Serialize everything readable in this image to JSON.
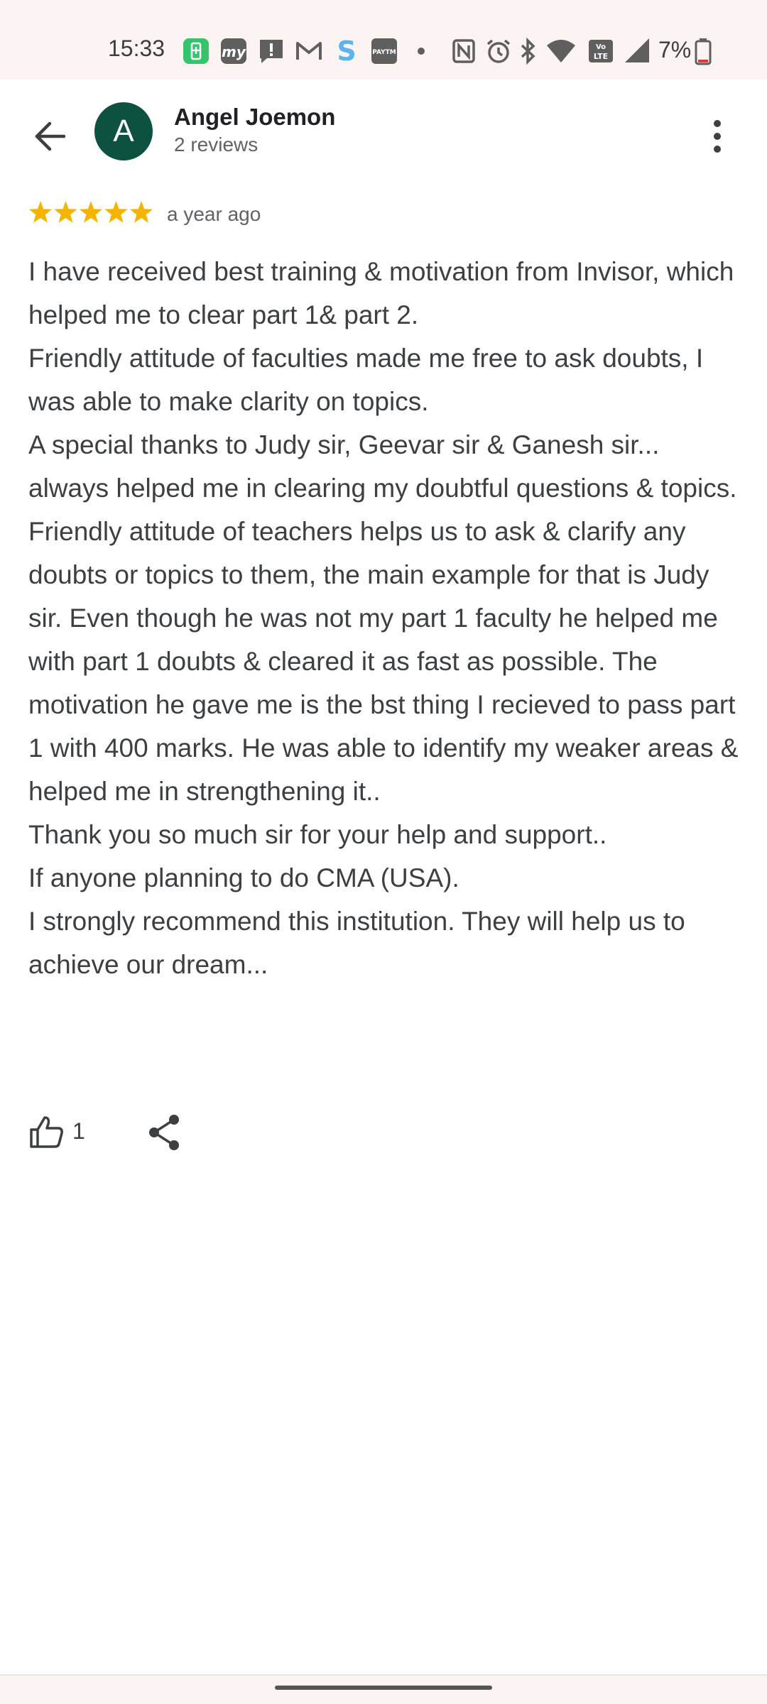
{
  "status_bar": {
    "time": "15:33",
    "battery": "7%",
    "icons": [
      "battery-saver-icon",
      "my-app-icon",
      "message-icon",
      "gmail-icon",
      "s-app-icon",
      "paytm-icon",
      "dot-icon",
      "nfc-icon",
      "alarm-icon",
      "bluetooth-icon",
      "wifi-icon",
      "volte-icon",
      "signal-icon",
      "battery-icon"
    ]
  },
  "header": {
    "avatar_letter": "A",
    "name": "Angel Joemon",
    "subtitle": "2 reviews",
    "avatar_color": "#0d5141"
  },
  "review": {
    "rating": 5,
    "time": "a year ago",
    "star_color": "#f4b400",
    "lines": [
      "I have received best training & motivation from Invisor, which helped me to clear part 1& part 2.",
      "Friendly attitude of faculties made me free to ask doubts, I was able to make clarity on topics.",
      "A special thanks to Judy sir, Geevar sir & Ganesh sir... always helped me in clearing my doubtful questions & topics.",
      "Friendly attitude of teachers helps us to ask & clarify any doubts or topics to them, the main example for that is Judy sir. Even though he was not my part 1 faculty he helped me with part 1 doubts & cleared it as fast as possible. The motivation he gave me is the bst thing I recieved to pass part 1 with 400 marks. He was able to identify my weaker areas & helped me in strengthening it..",
      "Thank you so much sir for your help and support..",
      "If anyone planning to do CMA (USA).",
      "I strongly recommend this institution. They will help us to achieve our dream..."
    ]
  },
  "actions": {
    "like_count": "1"
  }
}
